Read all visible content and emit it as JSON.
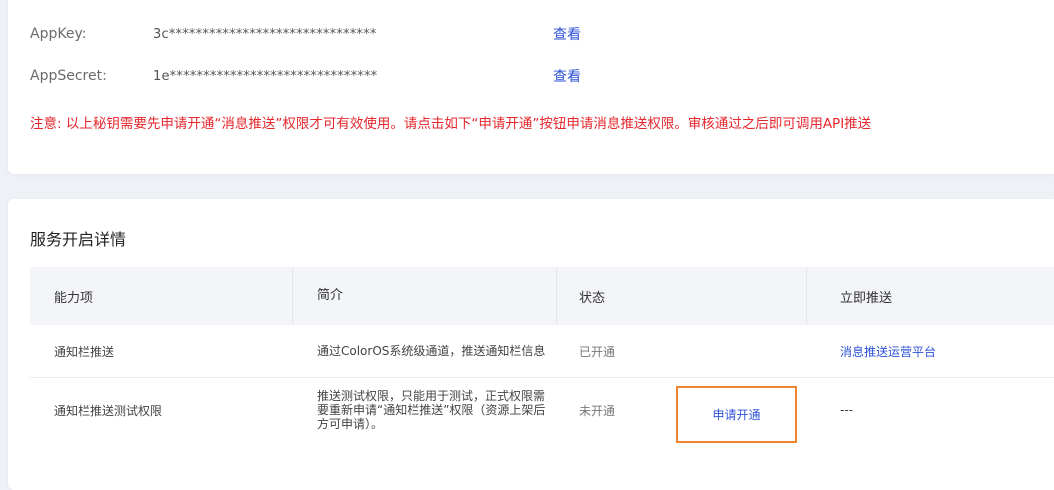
{
  "credentials": {
    "appkey_label": "AppKey:",
    "appkey_value": "3c*******************************",
    "appkey_view": "查看",
    "appsecret_label": "AppSecret:",
    "appsecret_value": "1e*******************************",
    "appsecret_view": "查看",
    "notice": "注意: 以上秘钥需要先申请开通“消息推送”权限才可有效使用。请点击如下“申请开通”按钮申请消息推送权限。审核通过之后即可调用API推送"
  },
  "services": {
    "title": "服务开启详情",
    "columns": [
      "能力项",
      "简介",
      "状态",
      "立即推送"
    ],
    "rows": [
      {
        "name": "通知栏推送",
        "desc": "通过ColorOS系统级通道，推送通知栏信息",
        "status": "已开通",
        "action": "",
        "push": "消息推送运营平台"
      },
      {
        "name": "通知栏推送测试权限",
        "desc": "推送测试权限，只能用于测试，正式权限需要重新申请“通知栏推送”权限（资源上架后方可申请）。",
        "status": "未开通",
        "action": "申请开通",
        "push": "---"
      }
    ]
  },
  "colors": {
    "link": "#2e52d6",
    "notice": "#e5272d",
    "highlight_border": "#f0852e"
  }
}
